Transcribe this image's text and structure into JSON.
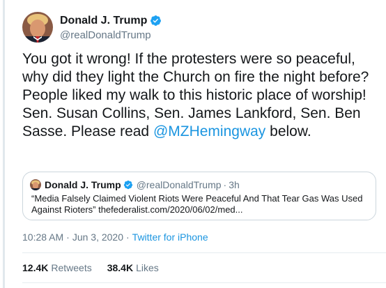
{
  "author": {
    "display_name": "Donald J. Trump",
    "handle": "@realDonaldTrump",
    "verified": true,
    "verified_color": "#1da1f2"
  },
  "tweet": {
    "text_before_mention": "You got it wrong! If the protesters were so peaceful, why did they light the Church on fire the night before? People liked my walk to this historic place of worship! Sen. Susan Collins, Sen. James Lankford, Sen. Ben Sasse. Please read ",
    "mention": "@MZHemingway",
    "text_after_mention": " below.",
    "mention_color": "#1b95e0"
  },
  "quoted_tweet": {
    "display_name": "Donald J. Trump",
    "handle": "@realDonaldTrump",
    "separator": "·",
    "time": "3h",
    "text": "“Media Falsely Claimed Violent Riots Were Peaceful And That Tear Gas Was Used Against Rioters”    thefederalist.com/2020/06/02/med..."
  },
  "meta": {
    "time": "10:28 AM",
    "date": "Jun 3, 2020",
    "separator1": "·",
    "separator2": "·",
    "client": "Twitter for iPhone"
  },
  "stats": {
    "retweets_count": "12.4K",
    "retweets_label": "Retweets",
    "likes_count": "38.4K",
    "likes_label": "Likes"
  },
  "colors": {
    "text_primary": "#14171a",
    "text_secondary": "#657786",
    "link": "#1b95e0",
    "border": "#ccd6dd"
  },
  "icons": {
    "avatar": "profile-photo",
    "verified": "verified-badge-icon"
  }
}
